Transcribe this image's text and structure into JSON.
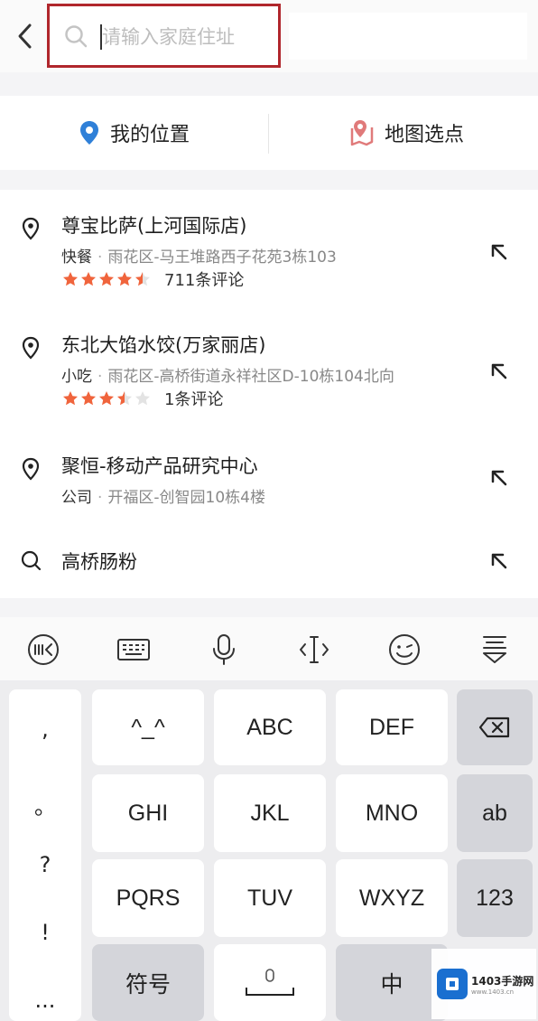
{
  "header": {
    "search_placeholder": "请输入家庭住址"
  },
  "location_bar": {
    "my_location": "我的位置",
    "map_pick": "地图选点"
  },
  "results": [
    {
      "title": "尊宝比萨(上河国际店)",
      "category": "快餐",
      "address": "雨花区-马王堆路西子花苑3栋103",
      "rating": 4.5,
      "reviews": "711条评论",
      "icon": "pin-icon"
    },
    {
      "title": "东北大馅水饺(万家丽店)",
      "category": "小吃",
      "address": "雨花区-高桥街道永祥社区D-10栋104北向",
      "rating": 3.5,
      "reviews": "1条评论",
      "icon": "pin-icon"
    },
    {
      "title": "聚恒-移动产品研究中心",
      "category": "公司",
      "address": "开福区-创智园10栋4楼",
      "icon": "pin-icon"
    },
    {
      "title": "高桥肠粉",
      "icon": "search-icon"
    }
  ],
  "keyboard": {
    "punctuation": [
      ",",
      "。",
      "?",
      "!",
      "..."
    ],
    "rows": [
      [
        "^_^",
        "ABC",
        "DEF"
      ],
      [
        "GHI",
        "JKL",
        "MNO"
      ],
      [
        "PQRS",
        "TUV",
        "WXYZ"
      ]
    ],
    "side_keys": [
      "ab",
      "123"
    ],
    "symbols": "符号",
    "chinese": "中"
  },
  "watermark": {
    "text": "1403手游网",
    "url": "www.1403.cn"
  },
  "colors": {
    "highlight_border": "#b0262c",
    "star": "#f0643c",
    "pin_blue": "#2f80d8",
    "map_pin": "#e07a7a"
  }
}
